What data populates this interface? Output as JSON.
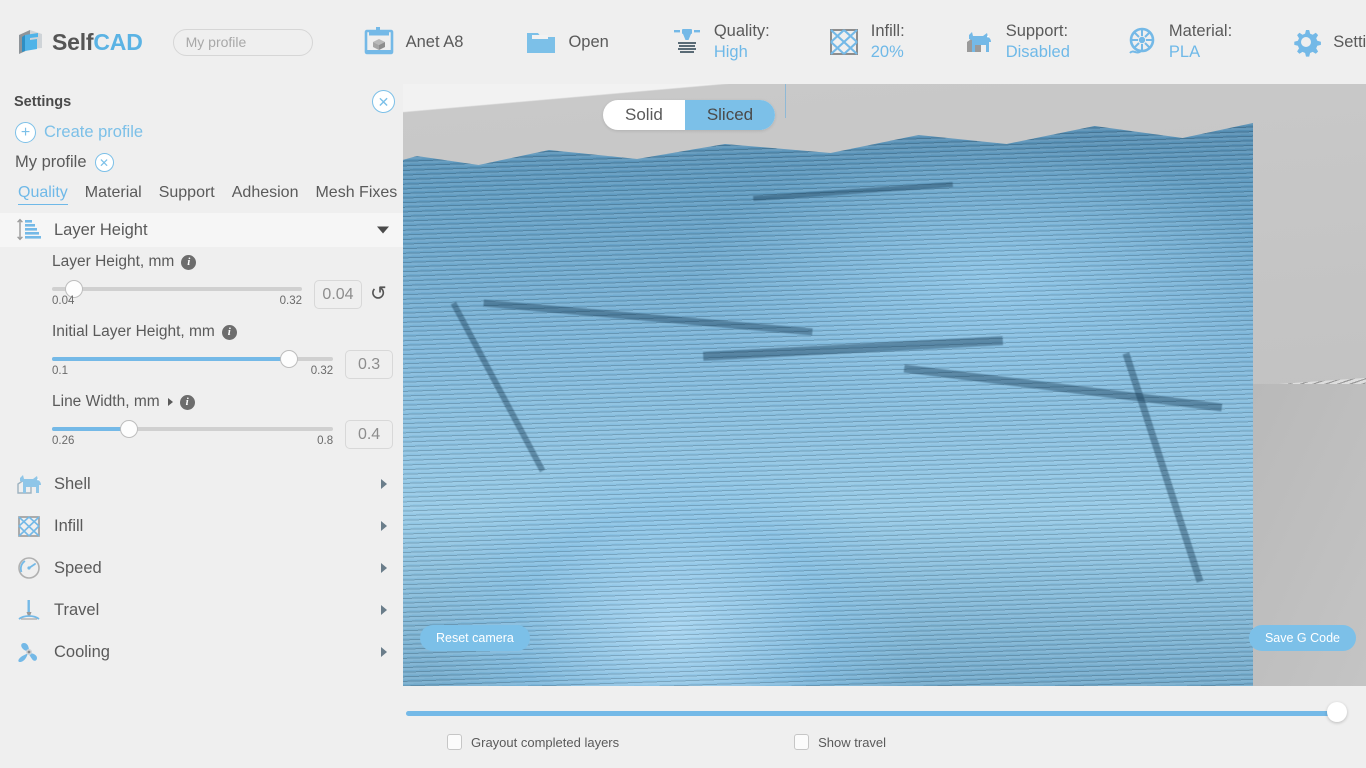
{
  "app": {
    "brand_first": "Self",
    "brand_second": "CAD",
    "accent": "#6fb9e8",
    "text": "#5a5a5a"
  },
  "topbar": {
    "profile_placeholder": "My profile",
    "profile_value": "",
    "items": [
      {
        "icon": "printer-icon",
        "label": "Anet A8"
      },
      {
        "icon": "folder-open-icon",
        "label": "Open"
      },
      {
        "icon": "nozzle-quality-icon",
        "key": "Quality:",
        "value": "High"
      },
      {
        "icon": "infill-grid-icon",
        "key": "Infill:",
        "value": "20%"
      },
      {
        "icon": "support-dog-icon",
        "key": "Support:",
        "value": "Disabled"
      },
      {
        "icon": "material-spool-icon",
        "key": "Material:",
        "value": "PLA"
      },
      {
        "icon": "gear-icon",
        "label": "Settings"
      }
    ]
  },
  "sidebar": {
    "title": "Settings",
    "close_label": "✕",
    "create_profile": "Create profile",
    "create_plus": "+",
    "profile_name": "My profile",
    "profile_remove": "✕",
    "tabs": [
      {
        "label": "Quality",
        "active": true
      },
      {
        "label": "Material",
        "active": false
      },
      {
        "label": "Support",
        "active": false
      },
      {
        "label": "Adhesion",
        "active": false
      },
      {
        "label": "Mesh Fixes",
        "active": false
      }
    ],
    "open_section": {
      "icon": "layer-height-icon",
      "label": "Layer Height",
      "fields": [
        {
          "label": "Layer Height, mm",
          "info": "i",
          "has_expander": false,
          "value": "0.04",
          "min": "0.04",
          "max": "0.32",
          "knob_pct": 0,
          "fill_pct": 0,
          "has_reset": true,
          "reset_glyph": "↺"
        },
        {
          "label": "Initial Layer Height, mm",
          "info": "i",
          "has_expander": false,
          "value": "0.3",
          "min": "0.1",
          "max": "0.32",
          "knob_pct": 88,
          "fill_pct": 88,
          "has_reset": false,
          "reset_glyph": ""
        },
        {
          "label": "Line Width, mm",
          "info": "i",
          "has_expander": true,
          "value": "0.4",
          "min": "0.26",
          "max": "0.8",
          "knob_pct": 27,
          "fill_pct": 27,
          "has_reset": false,
          "reset_glyph": ""
        }
      ]
    },
    "sections": [
      {
        "icon": "shell-dog-icon",
        "label": "Shell"
      },
      {
        "icon": "infill-grid-icon",
        "label": "Infill"
      },
      {
        "icon": "speed-gauge-icon",
        "label": "Speed"
      },
      {
        "icon": "travel-nozzle-icon",
        "label": "Travel"
      },
      {
        "icon": "cooling-fan-icon",
        "label": "Cooling"
      }
    ]
  },
  "viewport": {
    "view_modes": [
      {
        "label": "Solid",
        "active": false
      },
      {
        "label": "Sliced",
        "active": true
      }
    ],
    "reset_camera": "Reset camera",
    "save_gcode": "Save G Code"
  },
  "bottombar": {
    "layer_slider": {
      "value_pct": 98
    },
    "checkboxes": [
      {
        "label": "Grayout completed layers",
        "checked": false
      },
      {
        "label": "Show travel",
        "checked": false
      }
    ]
  }
}
